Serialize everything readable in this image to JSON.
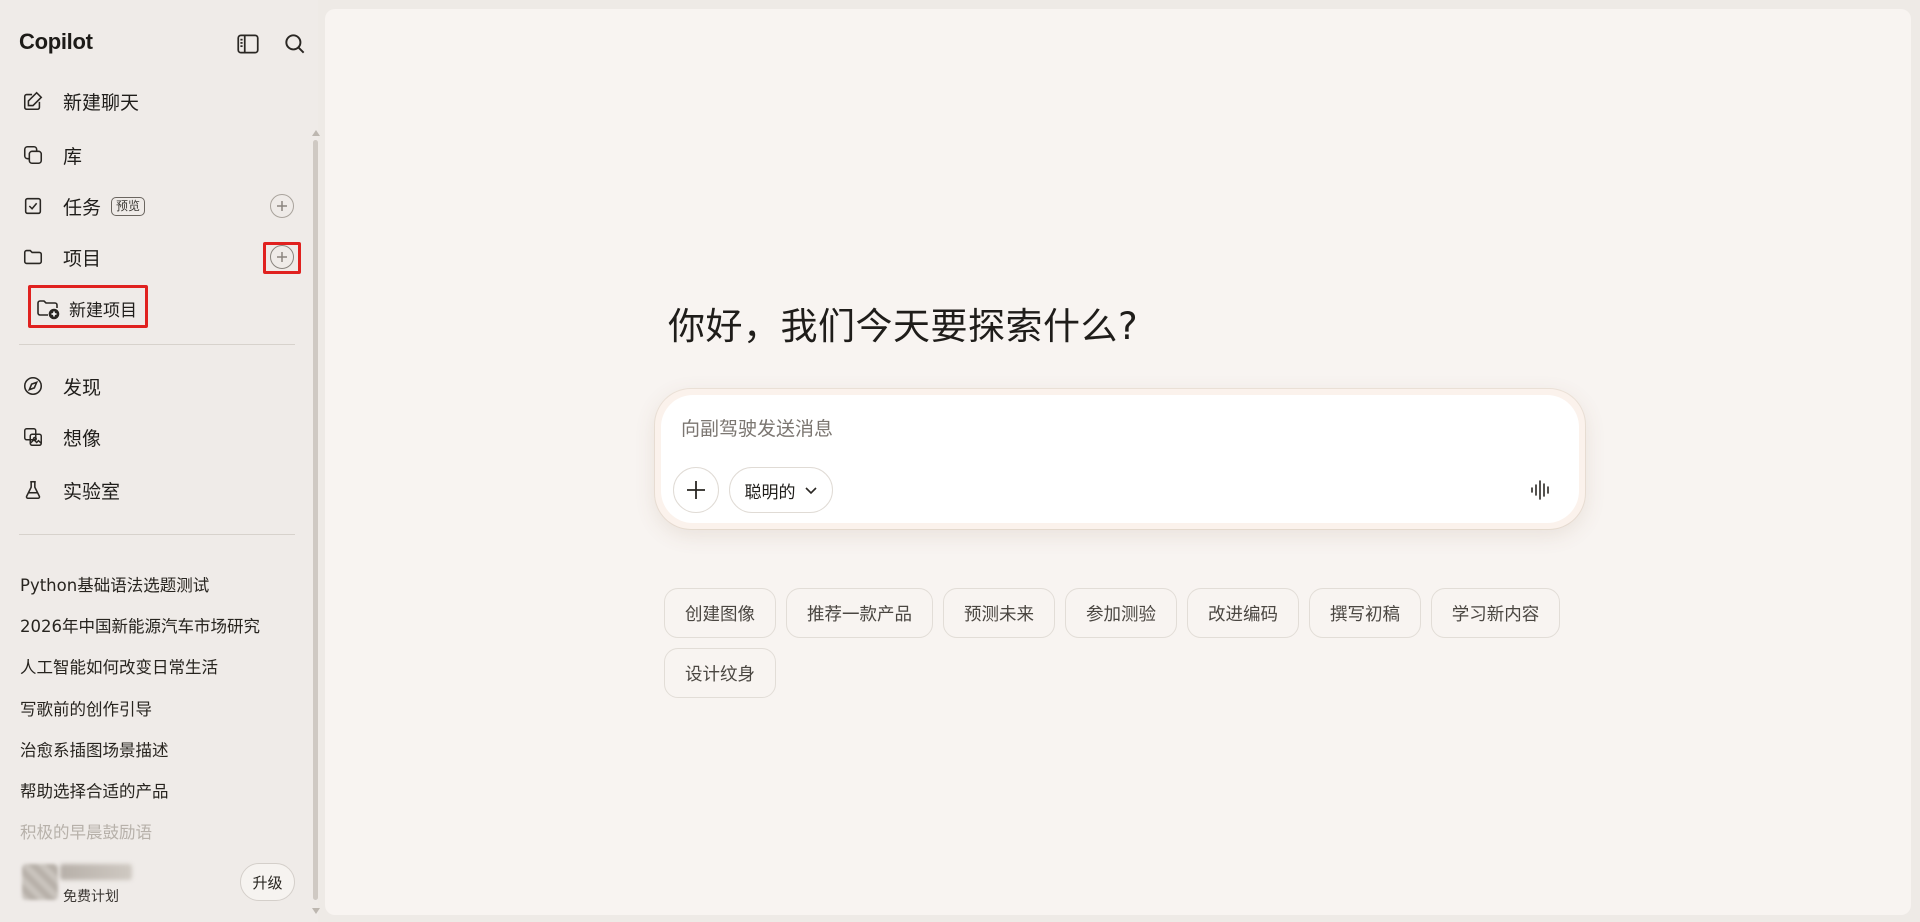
{
  "sidebar": {
    "brand": "Copilot",
    "nav": {
      "new_chat": "新建聊天",
      "library": "库",
      "tasks": "任务",
      "tasks_badge": "预览",
      "projects": "项目",
      "new_project": "新建项目",
      "discover": "发现",
      "imagine": "想像",
      "labs": "实验室"
    },
    "recent": [
      "Python基础语法选题测试",
      "2026年中国新能源汽车市场研究",
      "人工智能如何改变日常生活",
      "写歌前的创作引导",
      "治愈系插图场景描述",
      "帮助选择合适的产品",
      "积极的早晨鼓励语"
    ],
    "user": {
      "plan": "免费计划"
    },
    "upgrade": "升级"
  },
  "main": {
    "greeting": "你好，我们今天要探索什么?",
    "composer": {
      "placeholder": "向副驾驶发送消息",
      "mode": "聪明的"
    },
    "suggestions": [
      "创建图像",
      "推荐一款产品",
      "预测未来",
      "参加测验",
      "改进编码",
      "撰写初稿",
      "学习新内容",
      "设计纹身"
    ]
  },
  "colors": {
    "highlight": "#e0211f",
    "sidebar_bg": "#efebe8",
    "main_bg": "#f8f4f1"
  }
}
